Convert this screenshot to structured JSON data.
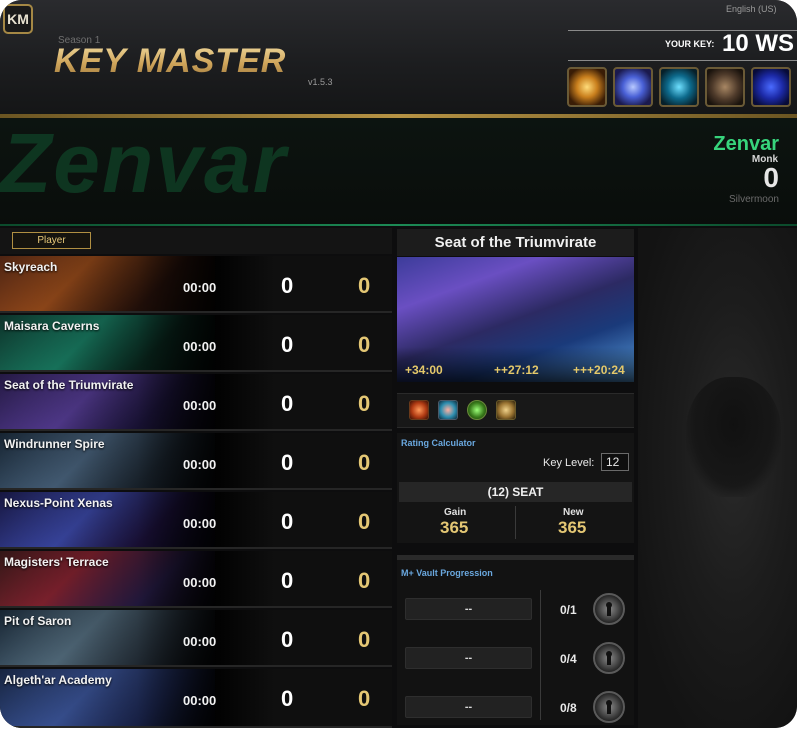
{
  "app": {
    "logo_text": "KM",
    "season": "Season 1",
    "title": "KEY MASTER",
    "version": "v1.5.3",
    "language": "English (US)"
  },
  "your_key": {
    "label": "YOUR KEY:",
    "value": "10 WS"
  },
  "affixes": [
    {
      "icon": "golden-orb-icon"
    },
    {
      "icon": "arcane-swirl-icon"
    },
    {
      "icon": "spectral-figure-icon"
    },
    {
      "icon": "hooded-figure-icon"
    },
    {
      "icon": "void-storm-icon"
    }
  ],
  "character": {
    "name": "Zenvar",
    "class": "Monk",
    "rating": "0",
    "realm": "Silvermoon",
    "class_color": "#37d47c"
  },
  "list": {
    "tab_label": "Player",
    "rows": [
      {
        "name": "Skyreach",
        "time": "00:00",
        "score": "0",
        "rating": "0"
      },
      {
        "name": "Maisara Caverns",
        "time": "00:00",
        "score": "0",
        "rating": "0"
      },
      {
        "name": "Seat of the Triumvirate",
        "time": "00:00",
        "score": "0",
        "rating": "0"
      },
      {
        "name": "Windrunner Spire",
        "time": "00:00",
        "score": "0",
        "rating": "0"
      },
      {
        "name": "Nexus-Point Xenas",
        "time": "00:00",
        "score": "0",
        "rating": "0"
      },
      {
        "name": "Magisters' Terrace",
        "time": "00:00",
        "score": "0",
        "rating": "0"
      },
      {
        "name": "Pit of Saron",
        "time": "00:00",
        "score": "0",
        "rating": "0"
      },
      {
        "name": "Algeth'ar Academy",
        "time": "00:00",
        "score": "0",
        "rating": "0"
      }
    ]
  },
  "selected_dungeon": {
    "title": "Seat of the Triumvirate",
    "timers": [
      "+34:00",
      "++27:12",
      "+++20:24"
    ],
    "icons": [
      "skull-book-icon",
      "map-scroll-icon",
      "eye-ring-icon",
      "keystone-emblem-icon"
    ]
  },
  "calculator": {
    "title": "Rating Calculator",
    "key_level_label": "Key Level:",
    "key_level": "12",
    "dungeon_line": "(12) SEAT",
    "gain_label": "Gain",
    "gain_value": "365",
    "new_label": "New",
    "new_value": "365"
  },
  "vault": {
    "title": "M+ Vault Progression",
    "slots": [
      {
        "text": "--",
        "count": "0/1"
      },
      {
        "text": "--",
        "count": "0/4"
      },
      {
        "text": "--",
        "count": "0/8"
      }
    ]
  },
  "colors": {
    "gold": "#e4c774",
    "accent_blue": "#6aa8df",
    "class_green": "#37d47c"
  }
}
